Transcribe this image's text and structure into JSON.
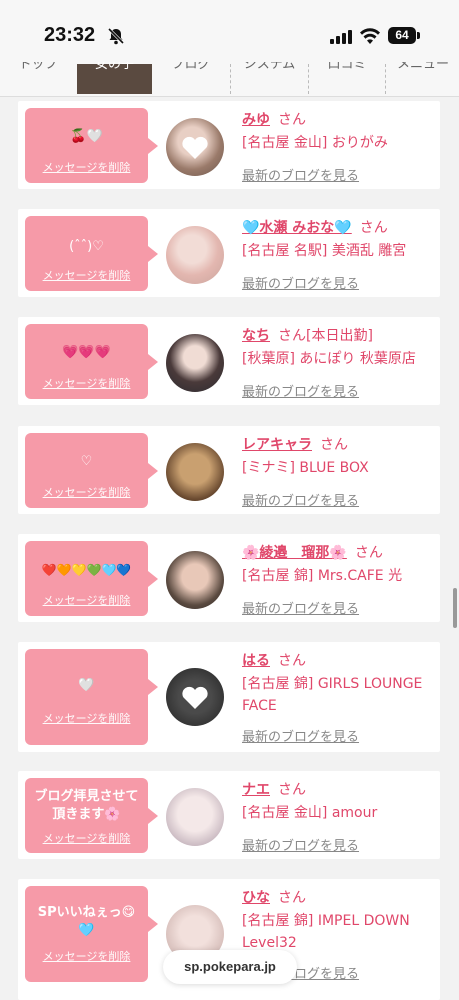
{
  "status": {
    "time": "23:32",
    "battery": "64"
  },
  "tabs": [
    "トップ",
    "女の子",
    "ブログ",
    "システム",
    "口コミ",
    "メニュー"
  ],
  "card_action": {
    "delete_label": "メッセージを削除",
    "blog_label": "最新のブログを見る",
    "san": "さん"
  },
  "cards": [
    {
      "message": "🍒🤍",
      "name": "みゆ",
      "extra": "",
      "shop": "[名古屋 金山] おりがみ"
    },
    {
      "message": "(ˆˆ)♡",
      "name": "🩵水瀬 みおな🩵",
      "extra": "",
      "shop": "[名古屋 名駅] 美酒乱 雕宮"
    },
    {
      "message": "💗💗💗",
      "name": "なち",
      "extra": "[本日出勤]",
      "shop": "[秋葉原] あにぽり 秋葉原店"
    },
    {
      "message": "♡",
      "name": "レアキャラ",
      "extra": "",
      "shop": "[ミナミ] BLUE BOX"
    },
    {
      "message": "❤️🧡💛💚🩵💙",
      "name": "🌸綾邉　瑠那🌸",
      "extra": "",
      "shop": "[名古屋 錦] Mrs.CAFE 光"
    },
    {
      "message": "🤍",
      "name": "はる",
      "extra": "",
      "shop": "[名古屋 錦] GIRLS LOUNGE FACE"
    },
    {
      "message": "ブログ拝見させて頂きます🌸",
      "name": "ナエ",
      "extra": "",
      "shop": "[名古屋 金山] amour"
    },
    {
      "message": "SPいいねぇっ😋🩵",
      "name": "ひな",
      "extra": "",
      "shop": "[名古屋 錦] IMPEL DOWN Level32"
    }
  ],
  "url": "sp.pokepara.jp"
}
